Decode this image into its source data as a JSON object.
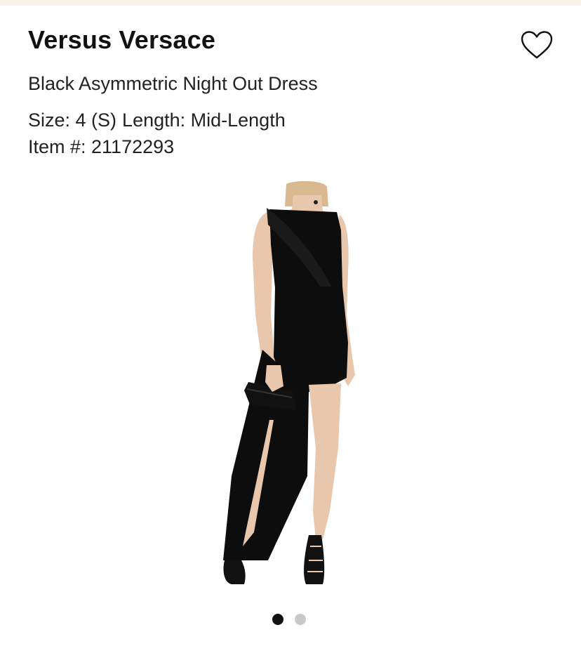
{
  "product": {
    "brand": "Versus Versace",
    "name": "Black Asymmetric Night Out Dress",
    "size_label": "Size: 4 (S)",
    "length_label": "Length: Mid-Length",
    "item_number": "Item #: 21172293"
  },
  "icons": {
    "favorite": "heart-outline-icon"
  },
  "gallery": {
    "total_images": 2,
    "active_index": 0
  },
  "colors": {
    "text": "#111111",
    "dress": "#0d0d0d",
    "skin": "#e8c7ad",
    "dot_active": "#111111",
    "dot_inactive": "#c8c8c8"
  }
}
